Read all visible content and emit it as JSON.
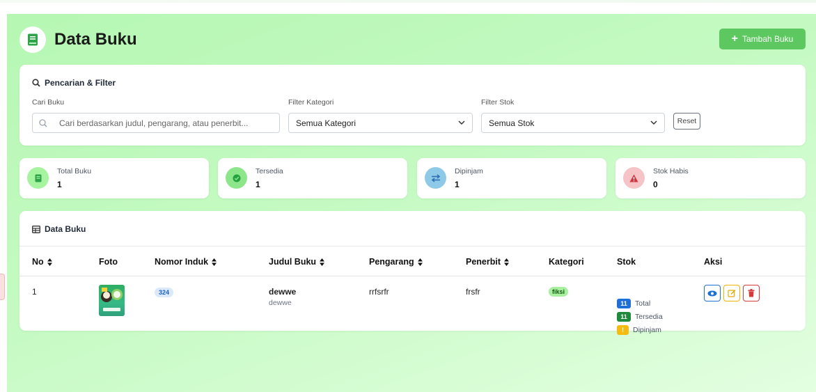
{
  "header": {
    "title": "Data Buku",
    "add_button": "Tambah Buku",
    "icon": "book-icon"
  },
  "filter": {
    "title": "Pencarian & Filter",
    "search_label": "Cari Buku",
    "search_placeholder": "Cari berdasarkan judul, pengarang, atau penerbit...",
    "category_label": "Filter Kategori",
    "category_value": "Semua Kategori",
    "stock_label": "Filter Stok",
    "stock_value": "Semua Stok",
    "reset": "Reset"
  },
  "stats": [
    {
      "label": "Total Buku",
      "value": "1",
      "icon": "book-icon",
      "color": "#a6f3a0"
    },
    {
      "label": "Tersedia",
      "value": "1",
      "icon": "check-circle-icon",
      "color": "#8ee68a"
    },
    {
      "label": "Dipinjam",
      "value": "1",
      "icon": "exchange-icon",
      "color": "#8ecae8"
    },
    {
      "label": "Stok Habis",
      "value": "0",
      "icon": "warning-icon",
      "color": "#f6c3c6"
    }
  ],
  "table": {
    "title": "Data Buku",
    "columns": [
      "No",
      "Foto",
      "Nomor Induk",
      "Judul Buku",
      "Pengarang",
      "Penerbit",
      "Kategori",
      "Stok",
      "Aksi"
    ],
    "rows": [
      {
        "no": "1",
        "nomor_induk": "324",
        "judul": "dewwe",
        "judul_sub": "dewwe",
        "pengarang": "rrfsrfr",
        "penerbit": "frsfr",
        "kategori": "fiksi",
        "stok_total": "11",
        "stok_total_label": "Total",
        "stok_tersedia": "11",
        "stok_tersedia_label": "Tersedia",
        "stok_dipinjam": "!",
        "stok_dipinjam_label": "Dipinjam"
      }
    ]
  },
  "colors": {
    "accent": "#5cc85f",
    "view": "#1f6fd9",
    "edit": "#f0b400",
    "delete": "#d43b3b"
  }
}
